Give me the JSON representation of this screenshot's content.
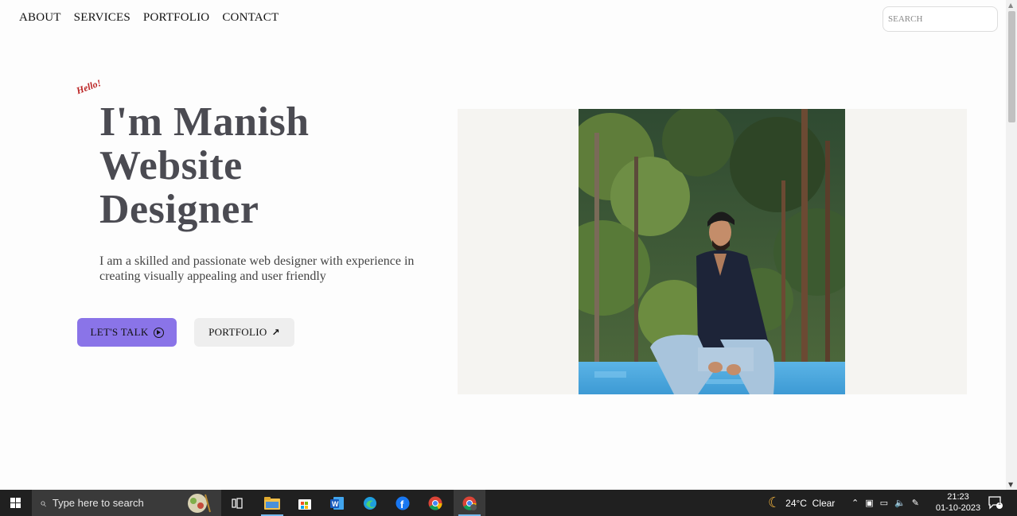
{
  "nav": {
    "items": [
      "ABOUT",
      "SERVICES",
      "PORTFOLIO",
      "CONTACT"
    ],
    "search_placeholder": "SEARCH"
  },
  "hero": {
    "hello": "Hello!",
    "headline": [
      "I'm Manish",
      "Website",
      "Designer"
    ],
    "description": "I am a skilled and passionate web designer with experience in creating visually appealing and user friendly",
    "buttons": {
      "talk": "LET'S TALK",
      "portfolio": "PORTFOLIO"
    }
  },
  "taskbar": {
    "search_placeholder": "Type here to search",
    "weather": "24°C  Clear",
    "time": "21:23",
    "date": "01-10-2023",
    "notification_count": "1",
    "apps": [
      "task-view",
      "file-explorer",
      "microsoft-store",
      "word",
      "edge",
      "facebook",
      "chrome",
      "chrome-profile"
    ]
  },
  "colors": {
    "accent": "#8a74e8",
    "headline": "#4b4b52",
    "hello": "#bb2222",
    "taskbar": "#202020"
  }
}
